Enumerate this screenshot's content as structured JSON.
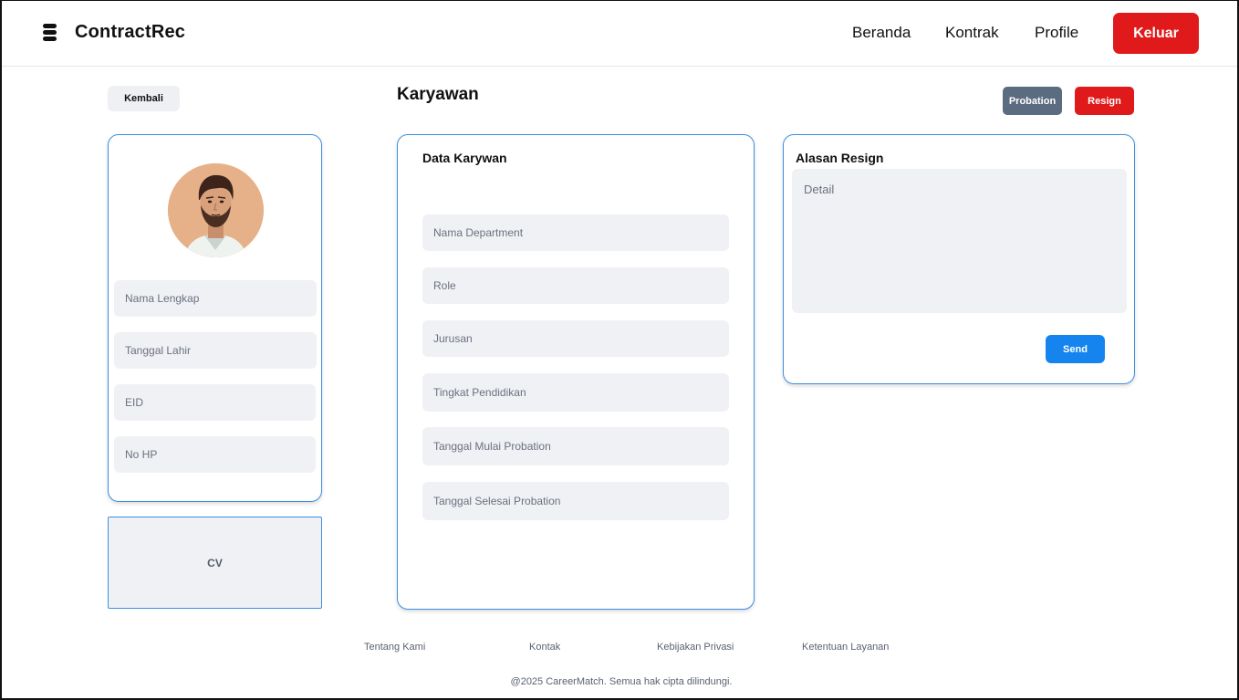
{
  "header": {
    "brand": "ContractRec",
    "nav": [
      "Beranda",
      "Kontrak",
      "Profile"
    ],
    "logout_label": "Keluar"
  },
  "toolbar": {
    "back_label": "Kembali",
    "page_title": "Karyawan",
    "probation_label": "Probation",
    "resign_label": "Resign"
  },
  "profile": {
    "fields": [
      "Nama Lengkap",
      "Tanggal Lahir",
      "EID",
      "No HP"
    ],
    "cv_label": "CV"
  },
  "data_card": {
    "title": "Data Karywan",
    "fields": [
      "Nama Department",
      "Role",
      "Jurusan",
      "Tingkat Pendidikan",
      "Tanggal Mulai Probation",
      "Tanggal Selesai Probation"
    ]
  },
  "resign_card": {
    "title": "Alasan Resign",
    "detail_placeholder": "Detail",
    "send_label": "Send"
  },
  "footer": {
    "links": [
      "Tentang Kami",
      "Kontak",
      "Kebijakan Privasi",
      "Ketentuan Layanan"
    ],
    "copyright": "@2025 CareerMatch. Semua hak cipta dilindungi."
  },
  "colors": {
    "accent_red": "#e01a1a",
    "accent_blue": "#1584ee",
    "card_border": "#3d8fe0",
    "probation_gray": "#5b6b80"
  }
}
